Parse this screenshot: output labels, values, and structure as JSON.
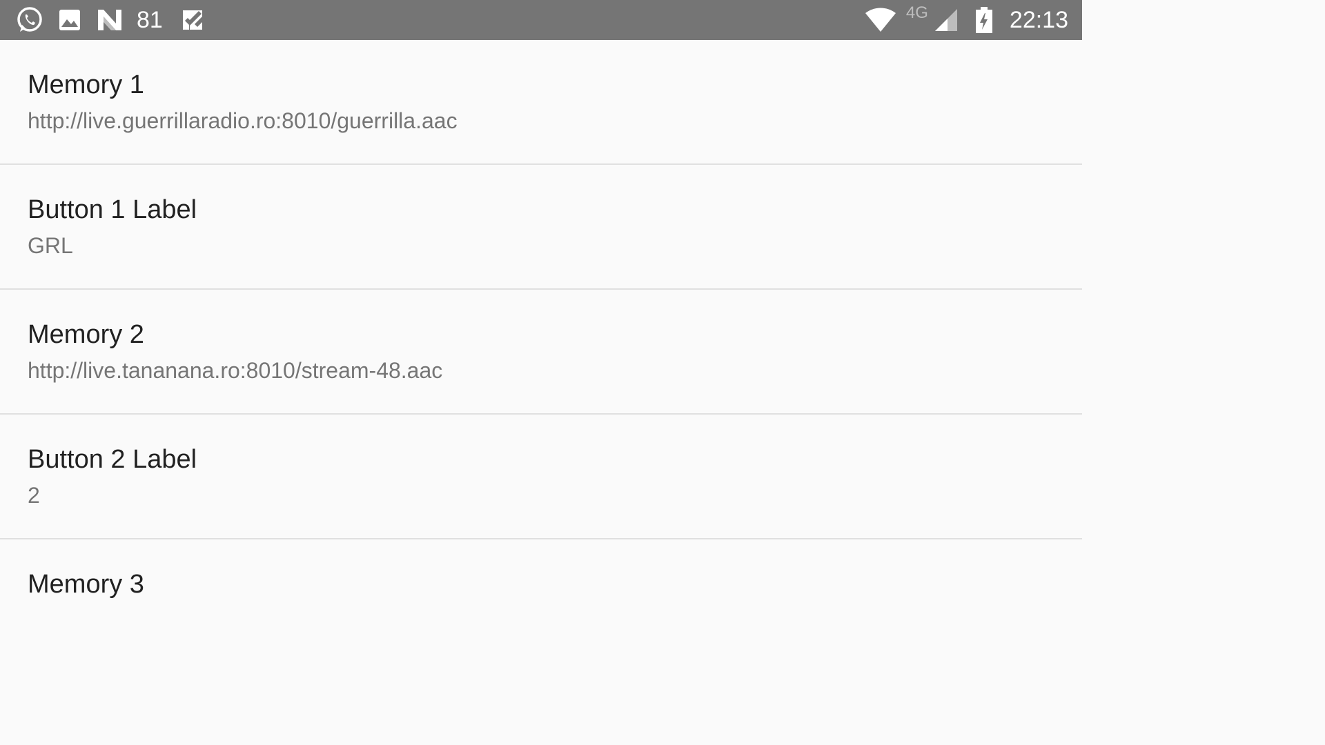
{
  "status_bar": {
    "notification_icons": [
      "whatsapp-icon",
      "gallery-icon",
      "n-app-icon"
    ],
    "notification_count": "81",
    "task_icon": "check-task-icon",
    "network_type": "4G",
    "clock": "22:13",
    "background_color": "#757575"
  },
  "preferences": [
    {
      "title": "Memory 1",
      "summary": "http://live.guerrillaradio.ro:8010/guerrilla.aac"
    },
    {
      "title": "Button 1 Label",
      "summary": "GRL"
    },
    {
      "title": "Memory 2",
      "summary": "http://live.tananana.ro:8010/stream-48.aac"
    },
    {
      "title": "Button 2 Label",
      "summary": "2"
    },
    {
      "title": "Memory 3",
      "summary": ""
    }
  ]
}
